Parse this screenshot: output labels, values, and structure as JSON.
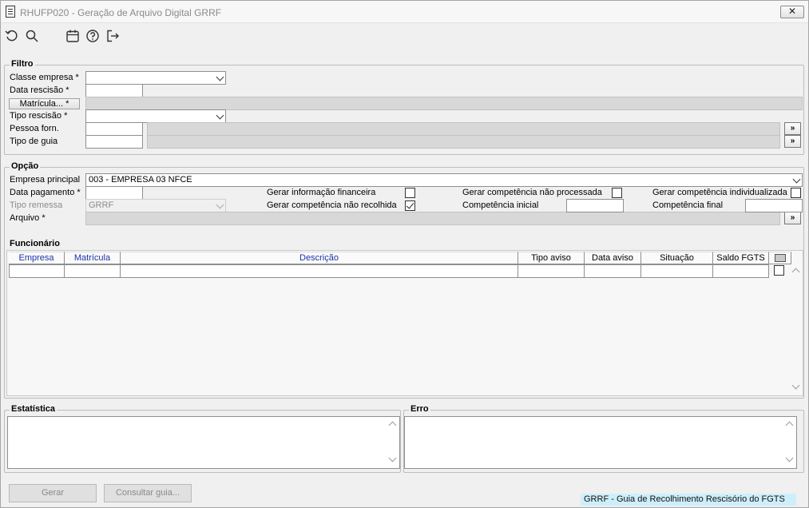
{
  "window": {
    "title": "RHUFP020 - Geração de Arquivo Digital GRRF",
    "close_label": "✕"
  },
  "toolbar": {
    "icons": [
      "undo-icon",
      "search-icon",
      "calendar-icon",
      "help-icon",
      "exit-icon"
    ]
  },
  "filtro": {
    "title": "Filtro",
    "classe_empresa_label": "Classe empresa *",
    "classe_empresa_value": "",
    "data_rescisao_label": "Data rescisão *",
    "data_rescisao_value": "",
    "matricula_label": "Matrícula... *",
    "tipo_rescisao_label": "Tipo rescisão *",
    "tipo_rescisao_value": "",
    "pessoa_forn_label": "Pessoa forn.",
    "pessoa_forn_value": "",
    "tipo_guia_label": "Tipo de guia",
    "tipo_guia_value": "",
    "more_button_label": "»"
  },
  "opcao": {
    "title": "Opção",
    "empresa_principal_label": "Empresa principal",
    "empresa_principal_value": "003 - EMPRESA 03 NFCE",
    "data_pagamento_label": "Data pagamento *",
    "data_pagamento_value": "",
    "tipo_remessa_label": "Tipo remessa",
    "tipo_remessa_value": "GRRF",
    "arquivo_label": "Arquivo *",
    "gerar_info_fin_label": "Gerar informação financeira",
    "gerar_info_fin_checked": false,
    "gerar_comp_nao_recolhida_label": "Gerar competência não recolhida",
    "gerar_comp_nao_recolhida_checked": true,
    "gerar_comp_nao_processada_label": "Gerar competência não processada",
    "gerar_comp_nao_processada_checked": false,
    "competencia_inicial_label": "Competência inicial",
    "competencia_inicial_value": "",
    "gerar_comp_individualizada_label": "Gerar competência individualizada",
    "gerar_comp_individualizada_checked": false,
    "competencia_final_label": "Competência final",
    "competencia_final_value": ""
  },
  "funcionario": {
    "title": "Funcionário",
    "columns": [
      "Empresa",
      "Matrícula",
      "Descrição",
      "Tipo aviso",
      "Data aviso",
      "Situação",
      "Saldo FGTS"
    ]
  },
  "estatistica": {
    "title": "Estatística",
    "value": ""
  },
  "erro": {
    "title": "Erro",
    "value": ""
  },
  "buttons": {
    "gerar": "Gerar",
    "consultar_guia": "Consultar guia..."
  },
  "status": "GRRF - Guia de Recolhimento Rescisório do FGTS"
}
